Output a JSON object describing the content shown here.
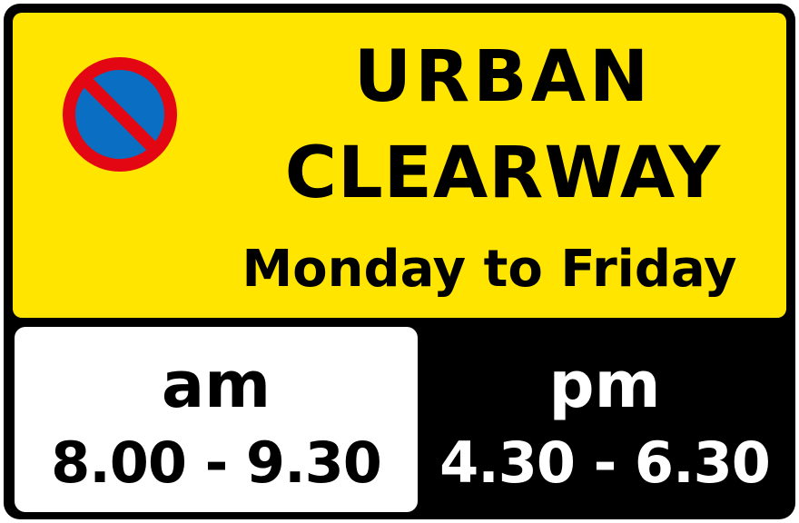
{
  "sign": {
    "title_line_1": "URBAN",
    "title_line_2": "CLEARWAY",
    "days": "Monday to Friday",
    "symbol": "no-waiting-icon",
    "colors": {
      "panel": "#ffe500",
      "symbol_ring": "#e30613",
      "symbol_fill": "#0a6fc2",
      "background": "#000000",
      "am_panel": "#ffffff"
    },
    "am": {
      "label": "am",
      "times": "8.00 - 9.30"
    },
    "pm": {
      "label": "pm",
      "times": "4.30 - 6.30"
    }
  }
}
